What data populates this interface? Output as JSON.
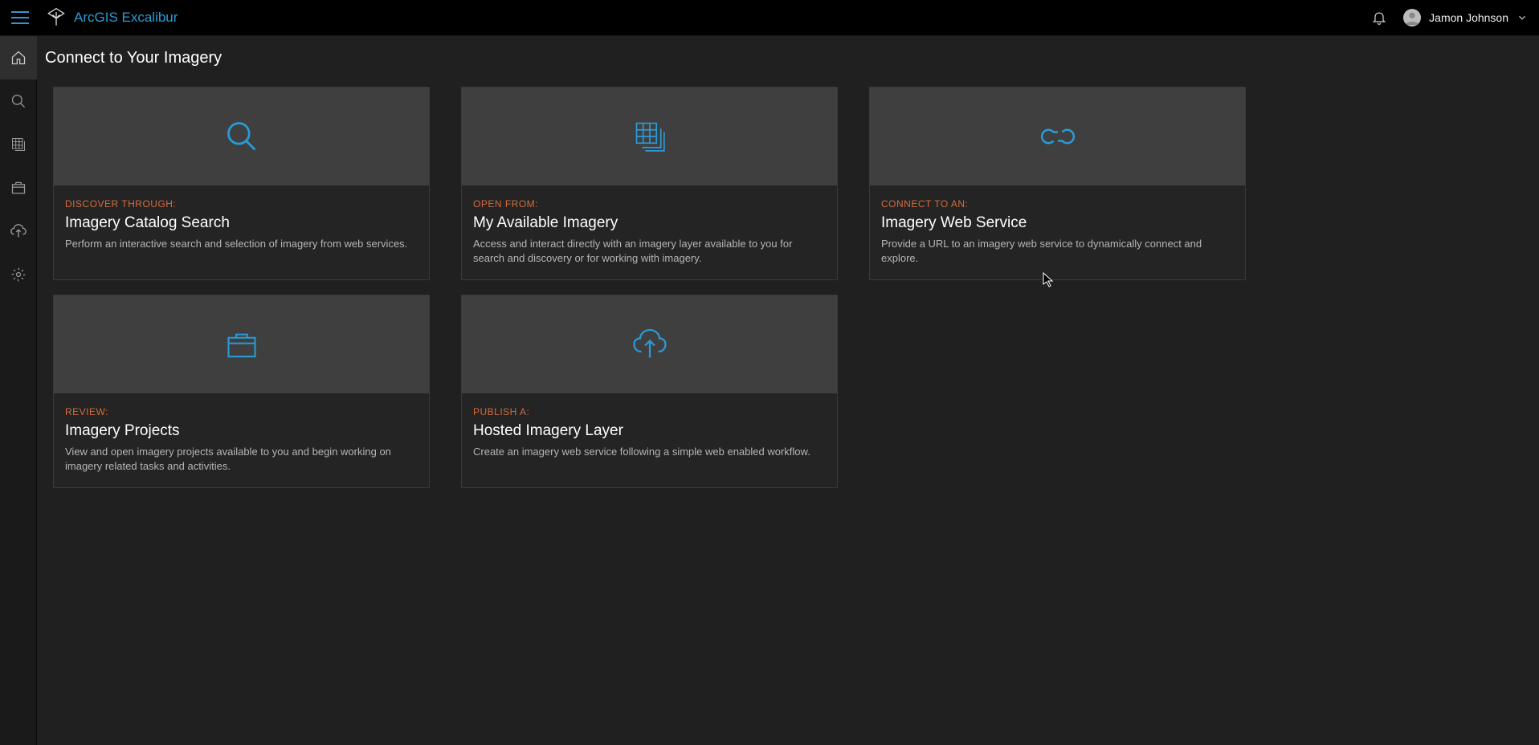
{
  "header": {
    "title": "ArcGIS Excalibur",
    "user": "Jamon Johnson"
  },
  "colors": {
    "accent": "#2b9bd6",
    "eyebrow": "#d46b3e"
  },
  "sidebar": {
    "items": [
      {
        "name": "home",
        "active": true
      },
      {
        "name": "search",
        "active": false
      },
      {
        "name": "grid",
        "active": false
      },
      {
        "name": "projects",
        "active": false
      },
      {
        "name": "upload",
        "active": false
      },
      {
        "name": "settings",
        "active": false
      }
    ]
  },
  "main": {
    "title": "Connect to Your Imagery",
    "cards": [
      {
        "icon": "search",
        "eyebrow": "DISCOVER THROUGH:",
        "title": "Imagery Catalog Search",
        "desc": "Perform an interactive search and selection of imagery from web services."
      },
      {
        "icon": "grid-stack",
        "eyebrow": "OPEN FROM:",
        "title": "My Available Imagery",
        "desc": "Access and interact directly with an imagery layer available to you for search and discovery or for working with imagery."
      },
      {
        "icon": "link",
        "eyebrow": "CONNECT TO AN:",
        "title": "Imagery Web Service",
        "desc": "Provide a URL to an imagery web service to dynamically connect and explore."
      },
      {
        "icon": "briefcase",
        "eyebrow": "REVIEW:",
        "title": "Imagery Projects",
        "desc": "View and open imagery projects available to you and begin working on imagery related tasks and activities."
      },
      {
        "icon": "cloud-up",
        "eyebrow": "PUBLISH A:",
        "title": "Hosted Imagery Layer",
        "desc": "Create an imagery web service following a simple web enabled workflow."
      }
    ]
  }
}
